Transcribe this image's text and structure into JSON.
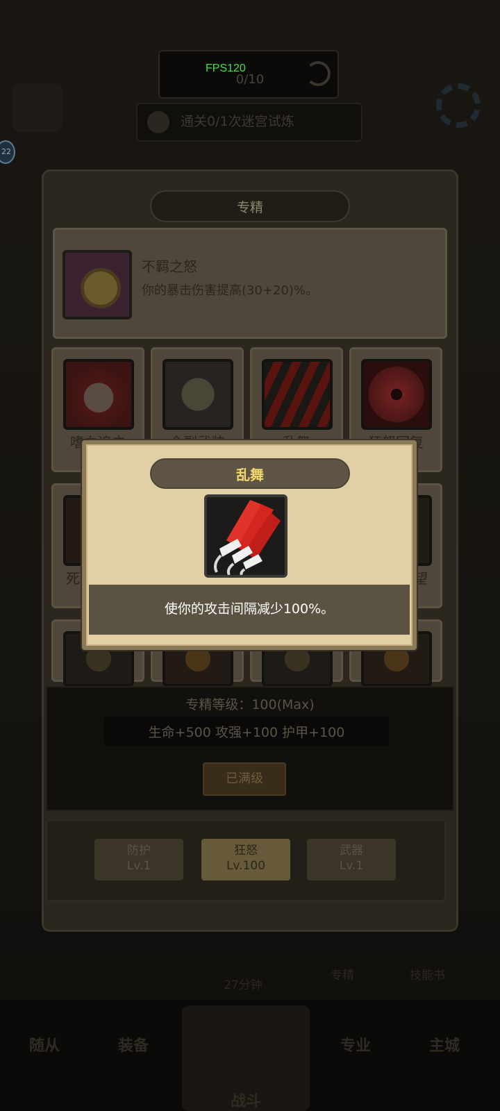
{
  "hud": {
    "fps": "FPS120",
    "counter": "0/10",
    "trial_text": "通关0/1次迷宫试炼"
  },
  "badge": "22",
  "panel": {
    "title": "专精",
    "selected": {
      "name": "不羁之怒",
      "desc": "你的暴击伤害提高(30+20)%。"
    },
    "skills_row1": [
      {
        "label": "嗜血追击",
        "icon": "fist-icon"
      },
      {
        "label": "全副武装",
        "icon": "helmet-icon"
      },
      {
        "label": "乱舞",
        "icon": "claw-icon"
      },
      {
        "label": "狂怒回复",
        "icon": "eye-icon"
      }
    ],
    "skills_row2": [
      {
        "label": "死",
        "icon": "shield-icon"
      },
      {
        "label": "望",
        "icon": "orb-icon"
      }
    ],
    "level_text": "专精等级：100(Max)",
    "bonus_text": "生命+500  攻强+100  护甲+100",
    "maxed_button": "已满级",
    "tabs": [
      {
        "name": "防护",
        "level": "Lv.1",
        "active": false
      },
      {
        "name": "狂怒",
        "level": "Lv.100",
        "active": true
      },
      {
        "name": "武器",
        "level": "Lv.1",
        "active": false
      }
    ]
  },
  "background": {
    "time": "27分钟",
    "specialty": "专精",
    "skill_book": "技能书"
  },
  "bottom_nav": {
    "followers": "随从",
    "equipment": "装备",
    "battle": "战斗",
    "profession": "专业",
    "main_city": "主城"
  },
  "popup": {
    "title": "乱舞",
    "icon": "claw-icon",
    "desc": "使你的攻击间隔减少100%。"
  }
}
